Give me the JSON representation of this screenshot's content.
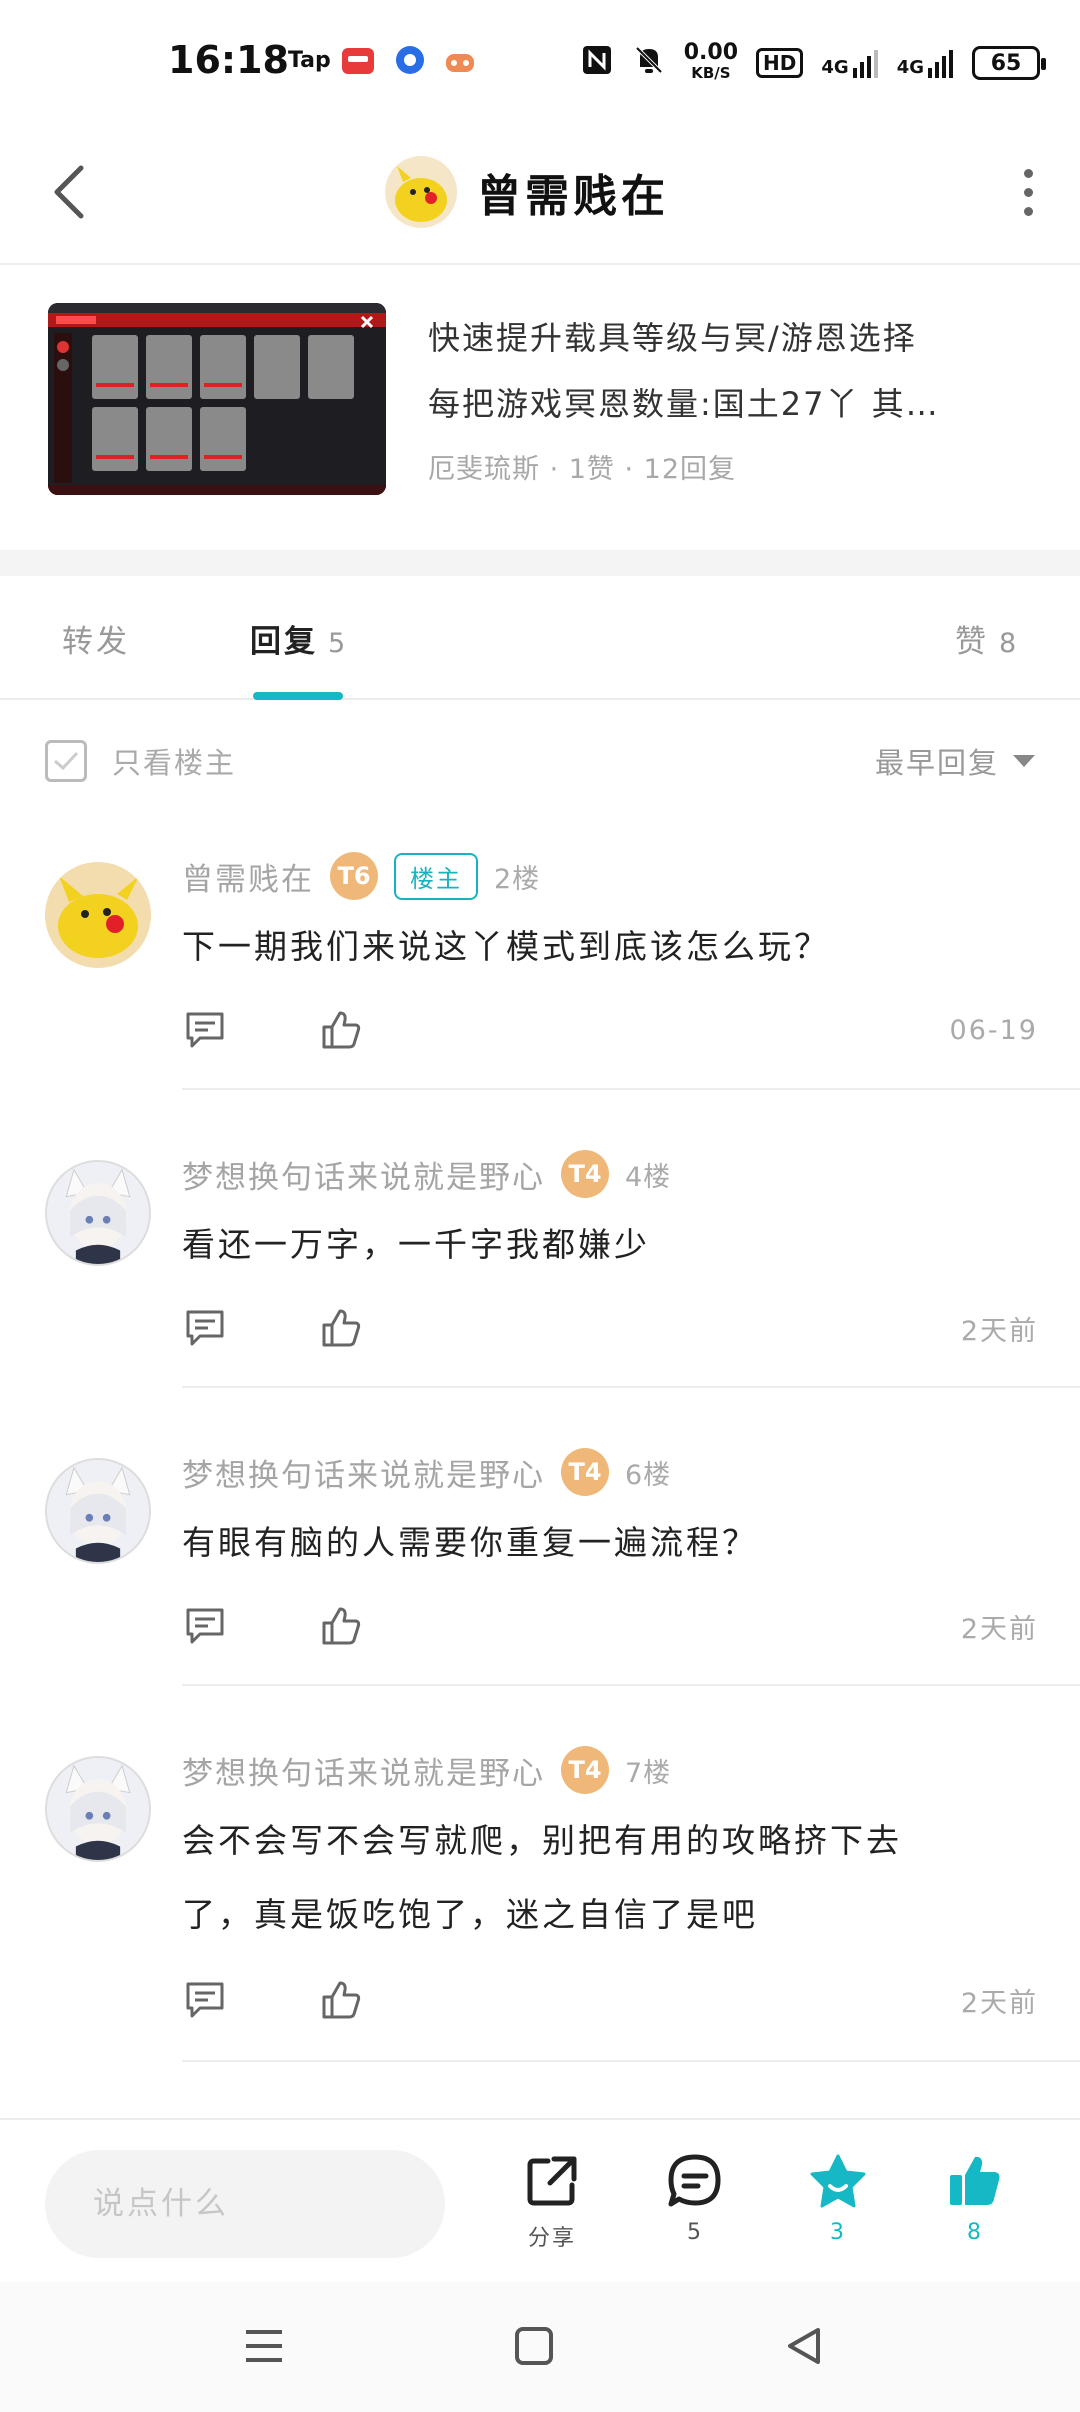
{
  "status_bar": {
    "time": "16:18",
    "tap_label": "Tap",
    "network_speed": "0.00",
    "network_unit": "KB/S",
    "hd": "HD",
    "net1": "4G",
    "net2": "4G",
    "battery": "65"
  },
  "header": {
    "title": "曾需贱在"
  },
  "post": {
    "line1": "快速提升载具等级与冥/游恩选择",
    "line2": "每把游戏冥恩数量:国土27丫 其…",
    "meta": "厄斐琉斯 · 1赞 · 12回复"
  },
  "tabs": {
    "repost": "转发",
    "reply": "回复",
    "reply_count": "5",
    "like": "赞",
    "like_count": "8"
  },
  "filter": {
    "only_owner": "只看楼主",
    "sort": "最早回复"
  },
  "comments": [
    {
      "name": "曾需贱在",
      "level": "T6",
      "owner_tag": "楼主",
      "floor": "2楼",
      "lines": [
        "下一期我们来说这丫模式到底该怎么玩？"
      ],
      "time": "06-19"
    },
    {
      "name": "梦想换句话来说就是野心",
      "level": "T4",
      "floor": "4楼",
      "lines": [
        "看还一万字，一千字我都嫌少"
      ],
      "time": "2天前"
    },
    {
      "name": "梦想换句话来说就是野心",
      "level": "T4",
      "floor": "6楼",
      "lines": [
        "有眼有脑的人需要你重复一遍流程？"
      ],
      "time": "2天前"
    },
    {
      "name": "梦想换句话来说就是野心",
      "level": "T4",
      "floor": "7楼",
      "lines": [
        "会不会写不会写就爬，别把有用的攻略挤下去",
        "了，真是饭吃饱了，迷之自信了是吧"
      ],
      "time": "2天前"
    }
  ],
  "bottom_bar": {
    "input_placeholder": "说点什么",
    "share_label": "分享",
    "comment_count": "5",
    "favorite_count": "3",
    "like_count": "8"
  },
  "colors": {
    "accent": "#15b8c4",
    "level_badge": "#f0b878"
  }
}
